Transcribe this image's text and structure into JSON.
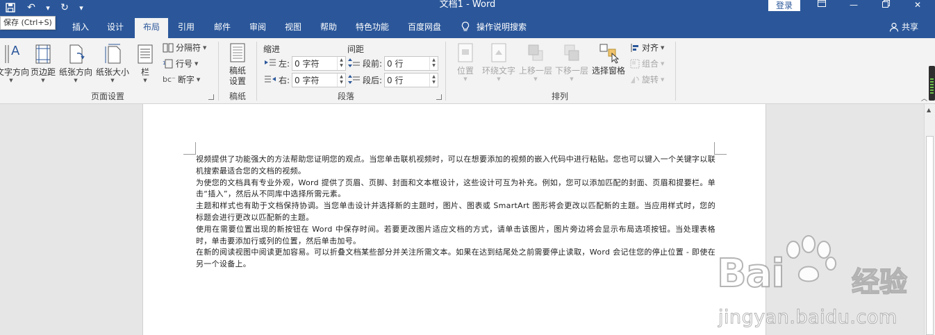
{
  "window": {
    "title": "文档1  -  Word",
    "login_label": "登录",
    "tooltip": "保存 (Ctrl+S)"
  },
  "tabs": [
    {
      "label": "插入"
    },
    {
      "label": "设计"
    },
    {
      "label": "布局",
      "active": true
    },
    {
      "label": "引用"
    },
    {
      "label": "邮件"
    },
    {
      "label": "审阅"
    },
    {
      "label": "视图"
    },
    {
      "label": "帮助"
    },
    {
      "label": "特色功能"
    },
    {
      "label": "百度网盘"
    }
  ],
  "tell_me": "操作说明搜索",
  "share_label": "共享",
  "ribbon": {
    "page_setup": {
      "label": "页面设置",
      "text_direction": "文字方向",
      "margins": "页边距",
      "orientation": "纸张方向",
      "size": "纸张大小",
      "columns": "栏",
      "breaks": "分隔符",
      "line_numbers": "行号",
      "hyphenation": "断字"
    },
    "manuscript": {
      "label": "稿纸",
      "button_line1": "稿纸",
      "button_line2": "设置"
    },
    "paragraph": {
      "label": "段落",
      "indent_title": "缩进",
      "spacing_title": "间距",
      "left_label": "左:",
      "left_value": "0 字符",
      "right_label": "右:",
      "right_value": "0 字符",
      "before_label": "段前:",
      "before_value": "0 行",
      "after_label": "段后:",
      "after_value": "0 行"
    },
    "arrange": {
      "label": "排列",
      "position": "位置",
      "wrap_text": "环绕文字",
      "bring_forward": "上移一层",
      "send_backward": "下移一层",
      "selection_pane": "选择窗格",
      "align": "对齐",
      "group": "组合",
      "rotate": "旋转"
    }
  },
  "document": {
    "paragraphs": [
      "视频提供了功能强大的方法帮助您证明您的观点。当您单击联机视频时，可以在想要添加的视频的嵌入代码中进行粘贴。您也可以键入一个关键字以联机搜索最适合您的文档的视频。",
      "为使您的文档具有专业外观，Word 提供了页眉、页脚、封面和文本框设计，这些设计可互为补充。例如，您可以添加匹配的封面、页眉和提要栏。单击“插入”，然后从不同库中选择所需元素。",
      "主题和样式也有助于文档保持协调。当您单击设计并选择新的主题时，图片、图表或 SmartArt 图形将会更改以匹配新的主题。当应用样式时，您的标题会进行更改以匹配新的主题。",
      "使用在需要位置出现的新按钮在 Word 中保存时间。若要更改图片适应文档的方式，请单击该图片，图片旁边将会显示布局选项按钮。当处理表格时，单击要添加行或列的位置，然后单击加号。",
      "在新的阅读视图中阅读更加容易。可以折叠文档某些部分并关注所需文本。如果在达到结尾处之前需要停止读取，Word 会记住您的停止位置 - 即使在另一个设备上。"
    ]
  },
  "watermark": {
    "brand": "Bai",
    "brand_cn": "经验",
    "url": "jingyan.baidu.com"
  },
  "colors": {
    "word_blue": "#2b579a",
    "ribbon_bg": "#f3f3f3",
    "canvas_bg": "#e6e6e6"
  }
}
